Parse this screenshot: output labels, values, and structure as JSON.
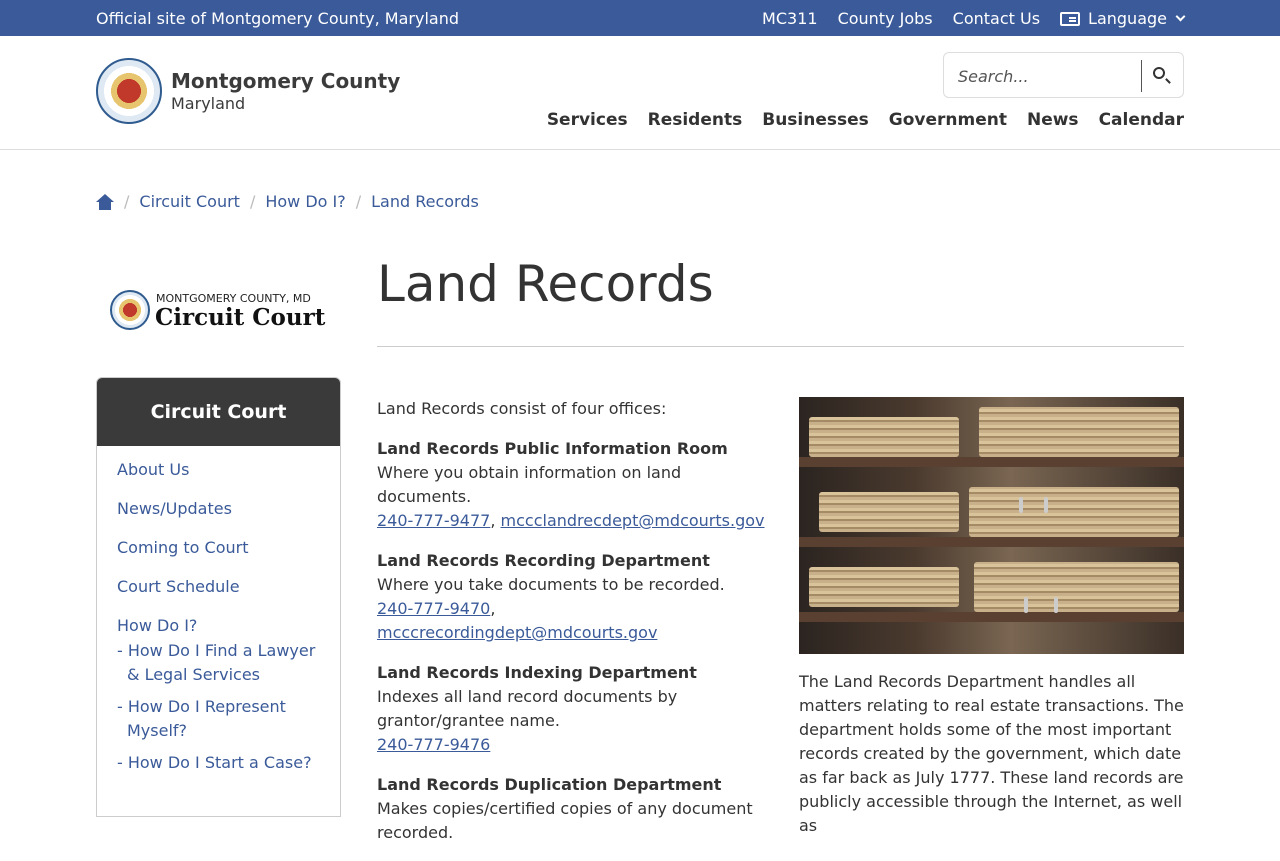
{
  "topbar": {
    "official": "Official site of Montgomery County, Maryland",
    "links": [
      "MC311",
      "County Jobs",
      "Contact Us"
    ],
    "language": "Language"
  },
  "header": {
    "brand_name": "Montgomery County",
    "brand_sub": "Maryland",
    "search_placeholder": "Search...",
    "nav": [
      "Services",
      "Residents",
      "Businesses",
      "Government",
      "News",
      "Calendar"
    ]
  },
  "breadcrumb": [
    "Circuit Court",
    "How Do I?",
    "Land Records"
  ],
  "court_logo": {
    "top": "MONTGOMERY COUNTY, MD",
    "main": "Circuit Court"
  },
  "sidenav": {
    "heading": "Circuit Court",
    "items": [
      "About Us",
      "News/Updates",
      "Coming to Court",
      "Court Schedule",
      "How Do I?"
    ],
    "subitems": [
      "- How Do I Find a Lawyer & Legal Services",
      "- How Do I Represent Myself?",
      "- How Do I Start a Case?"
    ]
  },
  "main": {
    "title": "Land Records",
    "intro": "Land Records consist of four offices:",
    "offices": [
      {
        "name": "Land Records Public Information Room",
        "desc": "Where you obtain information on land documents.",
        "phone": "240-777-9477",
        "email": "mccclandrecdept@mdcourts.gov"
      },
      {
        "name": "Land Records Recording Department",
        "desc": "Where you take documents to be recorded.",
        "phone": "240-777-9470",
        "email": "mcccrecordingdept@mdcourts.gov"
      },
      {
        "name": "Land Records Indexing Department",
        "desc": "Indexes all land record documents by grantor/grantee name.",
        "phone": "240-777-9476",
        "email": ""
      },
      {
        "name": "Land Records Duplication Department",
        "desc": "Makes copies/certified copies of any document recorded.",
        "phone": "",
        "email": ""
      }
    ],
    "side_paragraph": "The Land Records Department handles all matters relating to real estate transactions. The department holds some of the most important records created by the government, which date as far back as July 1777. These land records are publicly accessible through the Internet, as well as"
  }
}
